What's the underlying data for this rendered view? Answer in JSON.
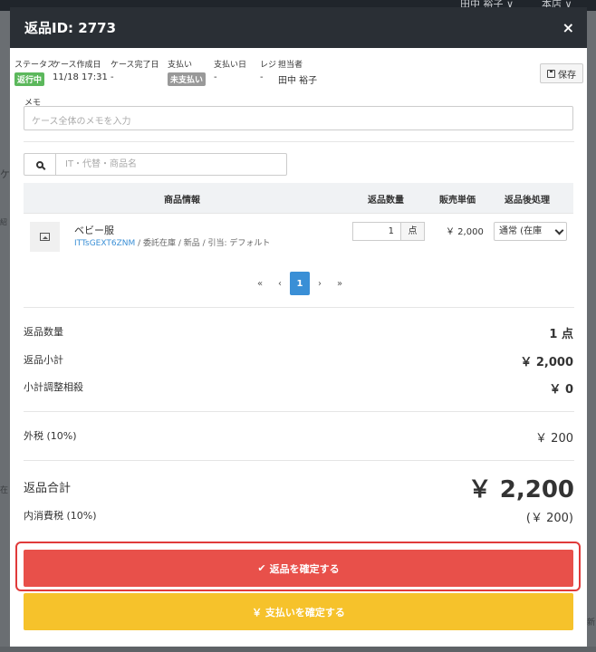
{
  "background": {
    "user": "田中 裕子 ∨",
    "store": "本店 ∨",
    "frag1": "ケ",
    "frag2": "紹",
    "frag3": "在",
    "frag4": "新"
  },
  "modal": {
    "title": "返品ID: 2773",
    "close": "×",
    "save_label": "保存"
  },
  "info": {
    "status_label": "ステータス",
    "status_value": "返行中",
    "created_label": "ケース作成日",
    "created_value": "11/18 17:31",
    "completed_label": "ケース完了日",
    "completed_value": "-",
    "payment_label": "支払い",
    "payment_value": "未支払い",
    "paydate_label": "支払い日",
    "paydate_value": "-",
    "register_label": "レジ",
    "register_value": "-",
    "staff_label": "担当者",
    "staff_value": "田中 裕子"
  },
  "memo": {
    "label": "メモ",
    "placeholder": "ケース全体のメモを入力"
  },
  "search": {
    "placeholder": "IT・代替・商品名"
  },
  "table": {
    "headers": [
      "商品情報",
      "返品数量",
      "販売単価",
      "返品後処理"
    ],
    "rows": [
      {
        "name": "ベビー服",
        "code": "ITTsGEXT6ZNM",
        "detail": " / 委託在庫 / 新品 / 引当: デフォルト",
        "qty": "1",
        "unit": "点",
        "price": "￥ 2,000",
        "process": "通常 (在庫"
      }
    ]
  },
  "pager": [
    "«",
    "‹",
    "1",
    "›",
    "»"
  ],
  "summary": {
    "return_qty_label": "返品数量",
    "return_qty_value": "1 点",
    "subtotal_label": "返品小計",
    "subtotal_value": "￥ 2,000",
    "adjust_label": "小計調整相殺",
    "adjust_value": "￥ 0",
    "tax_label": "外税 (10%)",
    "tax_value": "￥ 200",
    "total_label": "返品合計",
    "total_value": "￥ 2,200",
    "inc_tax_label": "内消費税 (10%)",
    "inc_tax_value": "(￥ 200)"
  },
  "buttons": {
    "confirm_return": "返品を確定する",
    "confirm_payment": "￥ 支払いを確定する"
  },
  "colors": {
    "header": "#2a2f35",
    "confirm": "#e8504a",
    "pay": "#f6c22b",
    "accent": "#3a8fd6"
  }
}
